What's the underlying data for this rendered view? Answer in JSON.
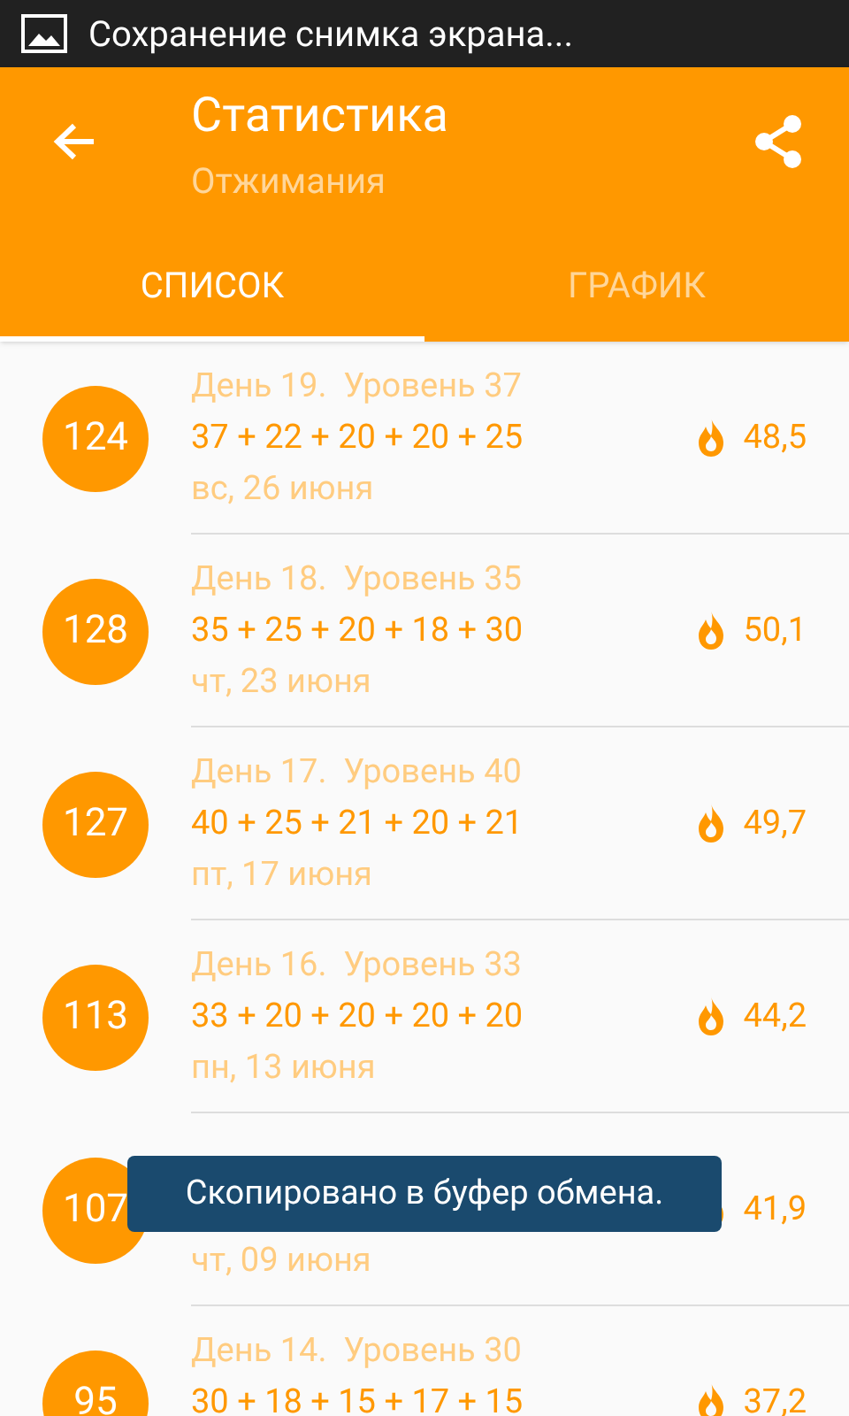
{
  "status_bar": {
    "notification": "Сохранение снимка экрана..."
  },
  "toolbar": {
    "title": "Статистика",
    "subtitle": "Отжимания"
  },
  "tabs": [
    {
      "label": "СПИСОК",
      "selected": true
    },
    {
      "label": "ГРАФИК",
      "selected": false
    }
  ],
  "rows": [
    {
      "total": "124",
      "title": "День 19.  Уровень 37",
      "sets": "37 + 22 + 20 + 20 + 25",
      "date": "вс, 26 июня",
      "kcal": "48,5"
    },
    {
      "total": "128",
      "title": "День 18.  Уровень 35",
      "sets": "35 + 25 + 20 + 18 + 30",
      "date": "чт, 23 июня",
      "kcal": "50,1"
    },
    {
      "total": "127",
      "title": "День 17.  Уровень 40",
      "sets": "40 + 25 + 21 + 20 + 21",
      "date": "пт, 17 июня",
      "kcal": "49,7"
    },
    {
      "total": "113",
      "title": "День 16.  Уровень 33",
      "sets": "33 + 20 + 20 + 20 + 20",
      "date": "пн, 13 июня",
      "kcal": "44,2"
    },
    {
      "total": "107",
      "date": "чт, 09 июня",
      "kcal": "41,9"
    },
    {
      "total": "95",
      "title": "День 14.  Уровень 30",
      "sets": "30 + 18 + 15 + 17 + 15",
      "kcal": "37,2"
    }
  ],
  "toast": {
    "text": "Скопировано в буфер обмена."
  }
}
